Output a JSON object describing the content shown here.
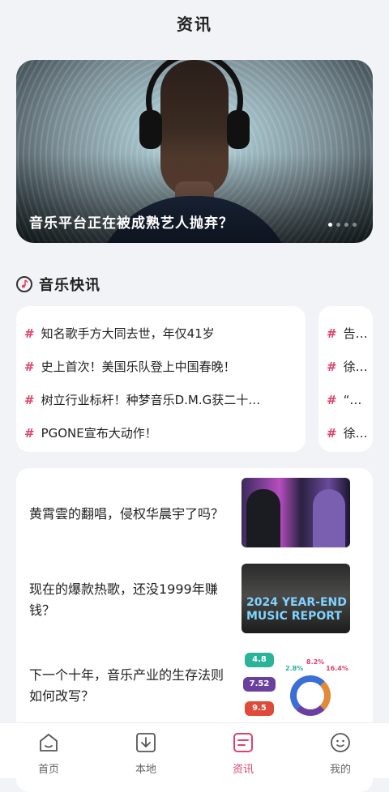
{
  "page": {
    "title": "资讯"
  },
  "banner": {
    "caption": "音乐平台正在被成熟艺人抛弃？",
    "dot_count": 4,
    "active_dot": 1
  },
  "flash": {
    "title": "音乐快讯",
    "card1": [
      "知名歌手方大同去世，年仅41岁",
      "史上首次！美国乐队登上中国春晚！",
      "树立行业标杆！种梦音乐D.M.G获二十…",
      "PGONE宣布大动作！"
    ],
    "card2": [
      "告五人",
      "徐怀钰",
      "“汪峰",
      "徐佳莹"
    ]
  },
  "news": [
    {
      "title": "黄霄雲的翻唱，侵权华晨宇了吗？"
    },
    {
      "title": "现在的爆款热歌，还没1999年赚钱？",
      "thumb_text": "2024 YEAR-END MUSIC REPORT"
    },
    {
      "title": "下一个十年，音乐产业的生存法则如何改写？",
      "chips": [
        "4.8",
        "7.52",
        "9.5",
        "2.8%",
        "8.2%",
        "16.4%"
      ]
    }
  ],
  "nav": {
    "items": [
      {
        "label": "首页",
        "icon": "home-icon"
      },
      {
        "label": "本地",
        "icon": "download-icon"
      },
      {
        "label": "资讯",
        "icon": "news-icon",
        "active": true
      },
      {
        "label": "我的",
        "icon": "profile-icon"
      }
    ],
    "active_color": "#e0426a"
  }
}
